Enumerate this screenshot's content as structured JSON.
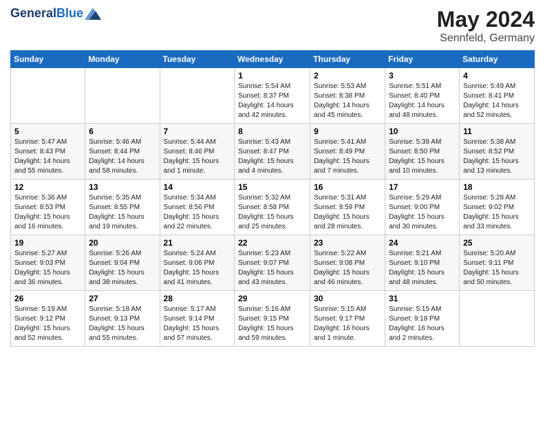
{
  "header": {
    "logo_line1": "General",
    "logo_line2": "Blue",
    "month_year": "May 2024",
    "location": "Sennfeld, Germany"
  },
  "days_of_week": [
    "Sunday",
    "Monday",
    "Tuesday",
    "Wednesday",
    "Thursday",
    "Friday",
    "Saturday"
  ],
  "weeks": [
    [
      {
        "day": "",
        "info": ""
      },
      {
        "day": "",
        "info": ""
      },
      {
        "day": "",
        "info": ""
      },
      {
        "day": "1",
        "info": "Sunrise: 5:54 AM\nSunset: 8:37 PM\nDaylight: 14 hours\nand 42 minutes."
      },
      {
        "day": "2",
        "info": "Sunrise: 5:53 AM\nSunset: 8:38 PM\nDaylight: 14 hours\nand 45 minutes."
      },
      {
        "day": "3",
        "info": "Sunrise: 5:51 AM\nSunset: 8:40 PM\nDaylight: 14 hours\nand 48 minutes."
      },
      {
        "day": "4",
        "info": "Sunrise: 5:49 AM\nSunset: 8:41 PM\nDaylight: 14 hours\nand 52 minutes."
      }
    ],
    [
      {
        "day": "5",
        "info": "Sunrise: 5:47 AM\nSunset: 8:43 PM\nDaylight: 14 hours\nand 55 minutes."
      },
      {
        "day": "6",
        "info": "Sunrise: 5:46 AM\nSunset: 8:44 PM\nDaylight: 14 hours\nand 58 minutes."
      },
      {
        "day": "7",
        "info": "Sunrise: 5:44 AM\nSunset: 8:46 PM\nDaylight: 15 hours\nand 1 minute."
      },
      {
        "day": "8",
        "info": "Sunrise: 5:43 AM\nSunset: 8:47 PM\nDaylight: 15 hours\nand 4 minutes."
      },
      {
        "day": "9",
        "info": "Sunrise: 5:41 AM\nSunset: 8:49 PM\nDaylight: 15 hours\nand 7 minutes."
      },
      {
        "day": "10",
        "info": "Sunrise: 5:39 AM\nSunset: 8:50 PM\nDaylight: 15 hours\nand 10 minutes."
      },
      {
        "day": "11",
        "info": "Sunrise: 5:38 AM\nSunset: 8:52 PM\nDaylight: 15 hours\nand 13 minutes."
      }
    ],
    [
      {
        "day": "12",
        "info": "Sunrise: 5:36 AM\nSunset: 8:53 PM\nDaylight: 15 hours\nand 16 minutes."
      },
      {
        "day": "13",
        "info": "Sunrise: 5:35 AM\nSunset: 8:55 PM\nDaylight: 15 hours\nand 19 minutes."
      },
      {
        "day": "14",
        "info": "Sunrise: 5:34 AM\nSunset: 8:56 PM\nDaylight: 15 hours\nand 22 minutes."
      },
      {
        "day": "15",
        "info": "Sunrise: 5:32 AM\nSunset: 8:58 PM\nDaylight: 15 hours\nand 25 minutes."
      },
      {
        "day": "16",
        "info": "Sunrise: 5:31 AM\nSunset: 8:59 PM\nDaylight: 15 hours\nand 28 minutes."
      },
      {
        "day": "17",
        "info": "Sunrise: 5:29 AM\nSunset: 9:00 PM\nDaylight: 15 hours\nand 30 minutes."
      },
      {
        "day": "18",
        "info": "Sunrise: 5:28 AM\nSunset: 9:02 PM\nDaylight: 15 hours\nand 33 minutes."
      }
    ],
    [
      {
        "day": "19",
        "info": "Sunrise: 5:27 AM\nSunset: 9:03 PM\nDaylight: 15 hours\nand 36 minutes."
      },
      {
        "day": "20",
        "info": "Sunrise: 5:26 AM\nSunset: 9:04 PM\nDaylight: 15 hours\nand 38 minutes."
      },
      {
        "day": "21",
        "info": "Sunrise: 5:24 AM\nSunset: 9:06 PM\nDaylight: 15 hours\nand 41 minutes."
      },
      {
        "day": "22",
        "info": "Sunrise: 5:23 AM\nSunset: 9:07 PM\nDaylight: 15 hours\nand 43 minutes."
      },
      {
        "day": "23",
        "info": "Sunrise: 5:22 AM\nSunset: 9:08 PM\nDaylight: 15 hours\nand 46 minutes."
      },
      {
        "day": "24",
        "info": "Sunrise: 5:21 AM\nSunset: 9:10 PM\nDaylight: 15 hours\nand 48 minutes."
      },
      {
        "day": "25",
        "info": "Sunrise: 5:20 AM\nSunset: 9:11 PM\nDaylight: 15 hours\nand 50 minutes."
      }
    ],
    [
      {
        "day": "26",
        "info": "Sunrise: 5:19 AM\nSunset: 9:12 PM\nDaylight: 15 hours\nand 52 minutes."
      },
      {
        "day": "27",
        "info": "Sunrise: 5:18 AM\nSunset: 9:13 PM\nDaylight: 15 hours\nand 55 minutes."
      },
      {
        "day": "28",
        "info": "Sunrise: 5:17 AM\nSunset: 9:14 PM\nDaylight: 15 hours\nand 57 minutes."
      },
      {
        "day": "29",
        "info": "Sunrise: 5:16 AM\nSunset: 9:15 PM\nDaylight: 15 hours\nand 59 minutes."
      },
      {
        "day": "30",
        "info": "Sunrise: 5:15 AM\nSunset: 9:17 PM\nDaylight: 16 hours\nand 1 minute."
      },
      {
        "day": "31",
        "info": "Sunrise: 5:15 AM\nSunset: 9:18 PM\nDaylight: 16 hours\nand 2 minutes."
      },
      {
        "day": "",
        "info": ""
      }
    ]
  ]
}
